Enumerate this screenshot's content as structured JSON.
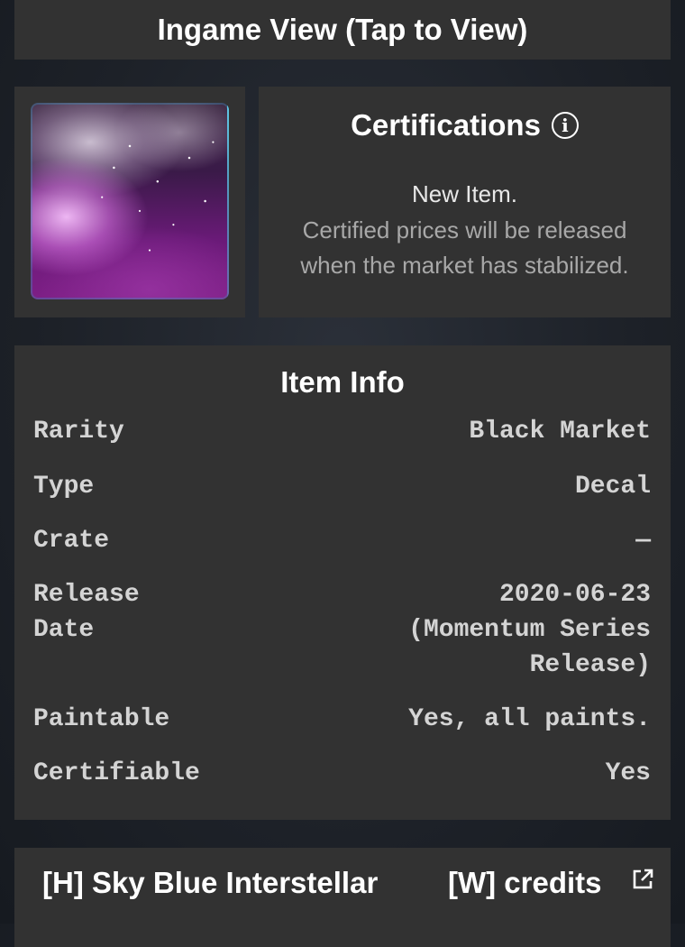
{
  "ingame": {
    "title": "Ingame View (Tap to View)"
  },
  "item": {
    "image": "sky-blue-interstellar-decal-thumbnail"
  },
  "certifications": {
    "title": "Certifications",
    "icon": "info-icon",
    "line1": "New Item.",
    "description": "Certified prices will be released when the market has stabilized."
  },
  "item_info": {
    "title": "Item Info",
    "rows": [
      {
        "label": "Rarity",
        "value": "Black Market"
      },
      {
        "label": "Type",
        "value": "Decal"
      },
      {
        "label": "Crate",
        "value": "—"
      },
      {
        "label": "Release\nDate",
        "value": "2020-06-23\n(Momentum Series\nRelease)"
      },
      {
        "label": "Paintable",
        "value": "Yes, all paints."
      },
      {
        "label": "Certifiable",
        "value": "Yes"
      }
    ]
  },
  "trade": {
    "have": "[H] Sky Blue Interstellar",
    "want": "[W] credits",
    "link_icon": "external-link-icon"
  },
  "colors": {
    "panel": "#323232",
    "background": "#1d2128",
    "label_text": "#d4d4d4",
    "muted_text": "#a8a8a8"
  }
}
